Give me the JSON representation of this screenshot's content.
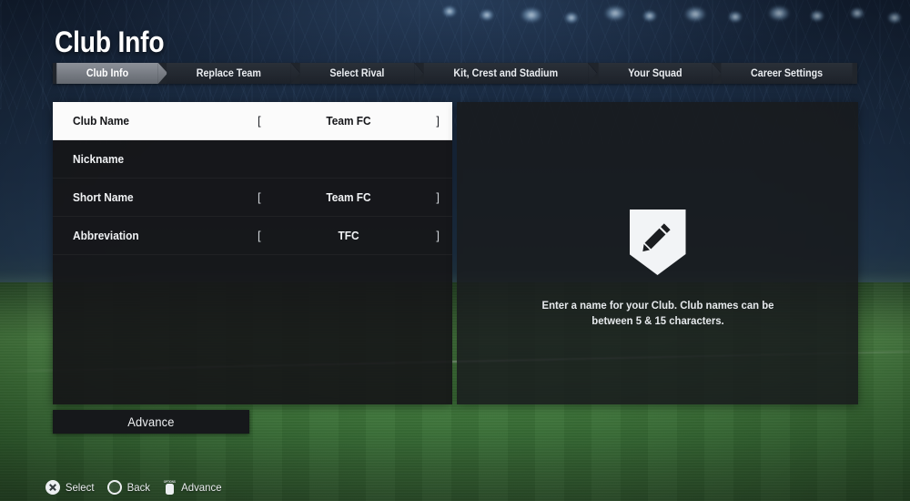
{
  "page": {
    "title": "Club Info"
  },
  "tabs": [
    {
      "label": "Club Info",
      "active": true
    },
    {
      "label": "Replace Team",
      "active": false
    },
    {
      "label": "Select Rival",
      "active": false
    },
    {
      "label": "Kit, Crest and Stadium",
      "active": false
    },
    {
      "label": "Your Squad",
      "active": false
    },
    {
      "label": "Career Settings",
      "active": false
    }
  ],
  "form": {
    "bracket_left": "[",
    "bracket_right": "]",
    "rows": [
      {
        "label": "Club Name",
        "value": "Team FC",
        "has_value": true,
        "selected": true
      },
      {
        "label": "Nickname",
        "value": "",
        "has_value": false,
        "selected": false
      },
      {
        "label": "Short Name",
        "value": "Team FC",
        "has_value": true,
        "selected": false
      },
      {
        "label": "Abbreviation",
        "value": "TFC",
        "has_value": true,
        "selected": false
      }
    ]
  },
  "info_panel": {
    "icon": "pencil-shield-icon",
    "description": "Enter a name for your Club. Club names can be between 5 & 15 characters."
  },
  "advance_button": {
    "label": "Advance"
  },
  "hints": [
    {
      "icon": "playstation-cross-button-icon",
      "label": "Select"
    },
    {
      "icon": "playstation-circle-button-icon",
      "label": "Back"
    },
    {
      "icon": "playstation-options-button-icon",
      "label": "Advance",
      "cap": "OPTIONS"
    }
  ],
  "colors": {
    "selected_row_bg": "#fbfbfb",
    "selected_row_text": "#141518",
    "panel_bg": "#151618",
    "active_tab_bg": "#8d9199",
    "tab_bg": "#2a3038",
    "accent_white": "#ffffff"
  }
}
